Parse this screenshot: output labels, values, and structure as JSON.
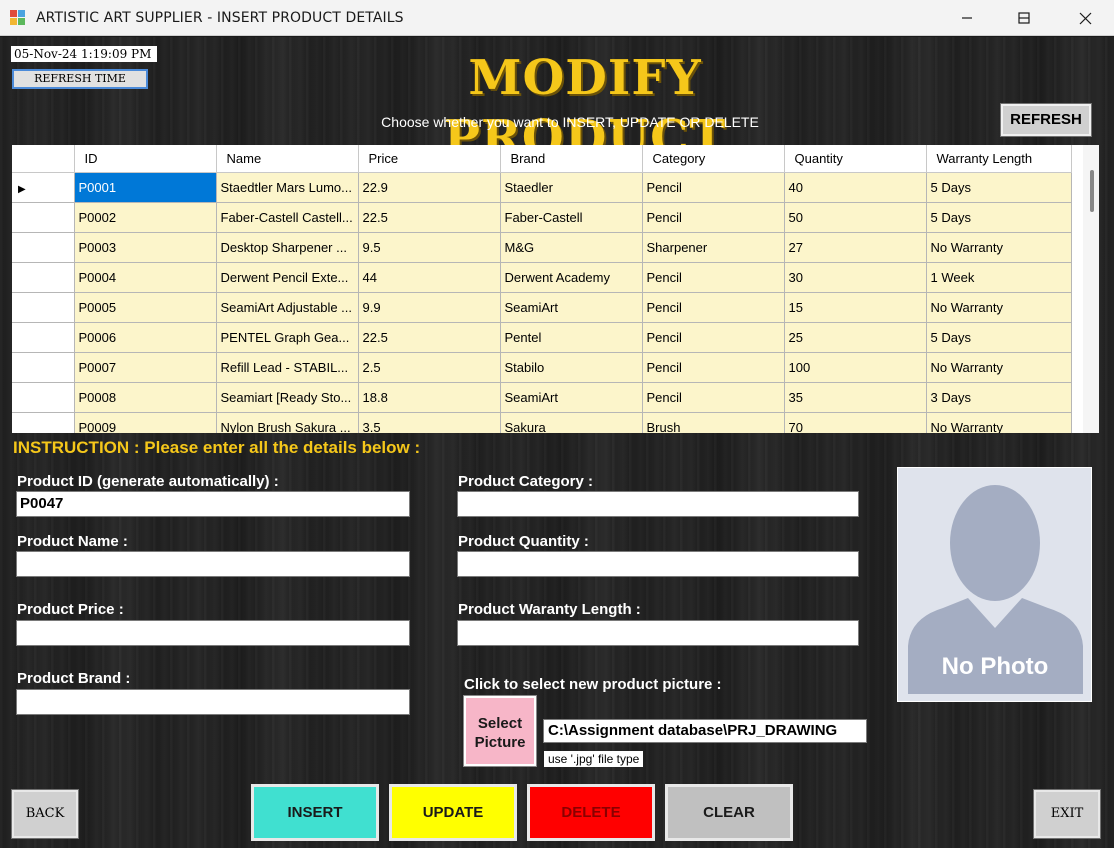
{
  "window": {
    "title": "ARTISTIC ART SUPPLIER - INSERT PRODUCT DETAILS",
    "minimize": "—",
    "maximize": "☐",
    "close": "✕"
  },
  "header": {
    "datetime": "05-Nov-24 1:19:09 PM",
    "refresh_time_label": "REFRESH TIME",
    "title": "MODIFY PRODUCT",
    "subtitle": "Choose whether you want to INSERT, UPDATE OR DELETE",
    "refresh_label": "REFRESH"
  },
  "grid": {
    "columns": [
      "ID",
      "Name",
      "Price",
      "Brand",
      "Category",
      "Quantity",
      "Warranty Length"
    ],
    "current_row_marker": "▶",
    "rows": [
      [
        "P0001",
        "Staedtler Mars Lumo...",
        "22.9",
        "Staedler",
        "Pencil",
        "40",
        "5 Days"
      ],
      [
        "P0002",
        "Faber-Castell Castell...",
        "22.5",
        "Faber-Castell",
        "Pencil",
        "50",
        "5 Days"
      ],
      [
        "P0003",
        "Desktop Sharpener ...",
        "9.5",
        "M&G",
        "Sharpener",
        "27",
        "No Warranty"
      ],
      [
        "P0004",
        "Derwent Pencil Exte...",
        "44",
        "Derwent Academy",
        "Pencil",
        "30",
        "1 Week"
      ],
      [
        "P0005",
        "SeamiArt Adjustable ...",
        "9.9",
        "SeamiArt",
        "Pencil",
        "15",
        "No Warranty"
      ],
      [
        "P0006",
        "PENTEL Graph Gea...",
        "22.5",
        "Pentel",
        "Pencil",
        "25",
        "5 Days"
      ],
      [
        "P0007",
        "Refill Lead - STABIL...",
        "2.5",
        "Stabilo",
        "Pencil",
        "100",
        "No Warranty"
      ],
      [
        "P0008",
        "Seamiart [Ready Sto...",
        "18.8",
        "SeamiArt",
        "Pencil",
        "35",
        "3 Days"
      ],
      [
        "P0009",
        "Nylon Brush Sakura ...",
        "3.5",
        "Sakura",
        "Brush",
        "70",
        "No Warranty"
      ]
    ]
  },
  "form": {
    "instruction": "INSTRUCTION : Please enter all the details below :",
    "product_id_label": "Product ID (generate automatically) :",
    "product_id_value": "P0047",
    "product_name_label": "Product Name :",
    "product_name_value": "",
    "product_price_label": "Product Price :",
    "product_price_value": "",
    "product_brand_label": "Product Brand :",
    "product_brand_value": "",
    "product_category_label": "Product Category :",
    "product_category_value": "",
    "product_quantity_label": "Product Quantity :",
    "product_quantity_value": "",
    "product_warranty_label": "Product Waranty Length :",
    "product_warranty_value": "",
    "picture_prompt": "Click to select new product picture :",
    "select_picture_line1": "Select",
    "select_picture_line2": "Picture",
    "picture_path": "C:\\Assignment database\\PRJ_DRAWING",
    "picture_hint": "use '.jpg' file type",
    "no_photo_text": "No Photo"
  },
  "actions": {
    "back": "BACK",
    "insert": "INSERT",
    "update": "UPDATE",
    "delete": "DELETE",
    "clear": "CLEAR",
    "exit": "EXIT"
  },
  "colors": {
    "title_gold": "#f5c71a",
    "row_bg": "#fcf5cb",
    "selected_cell": "#0078d7",
    "insert_bg": "#40e0d0",
    "update_bg": "#ffff00",
    "delete_bg": "#ff0000",
    "clear_bg": "#c0c0c0",
    "select_picture_bg": "#f7b6c8"
  }
}
